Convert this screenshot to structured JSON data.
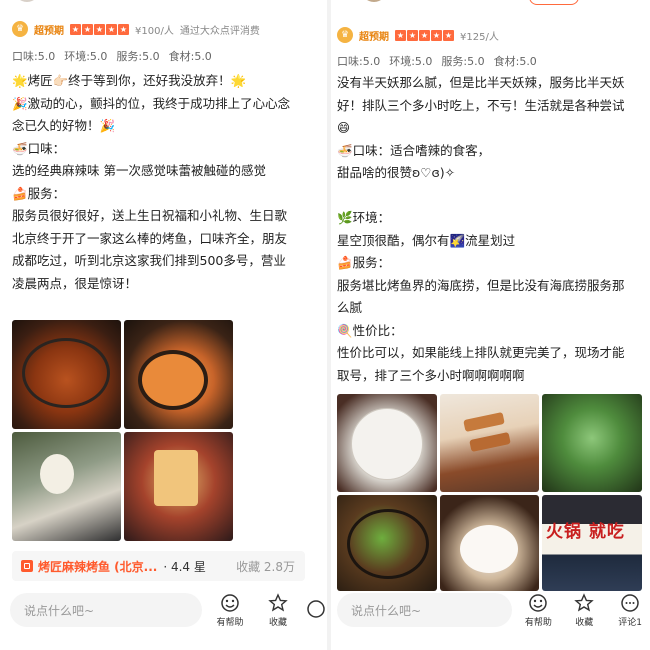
{
  "left": {
    "vip_label": "超预期",
    "price": "¥100/人",
    "verified": "通过大众点评消费",
    "scores": [
      "口味:5.0",
      "环境:5.0",
      "服务:5.0",
      "食材:5.0"
    ],
    "lines": [
      "🌟烤匠👉🏻终于等到你，还好我没放弃！🌟",
      "🎉激动的心，颤抖的位，我终于成功排上了心心念",
      "念已久的好物！🎉",
      "🍜口味：",
      "选的经典麻辣味 第一次感觉味蕾被触碰的感觉",
      "🍰服务：",
      "服务员很好很好，送上生日祝福和小礼物、生日歌",
      "北京终于开了一家这么棒的烤鱼，口味齐全，朋友",
      "成都吃过，听到北京这家我们排到500多号，营业",
      "凌晨两点，很是惊讶！"
    ],
    "poi": {
      "name": "烤匠麻辣烤鱼 (北京...",
      "rating": "· 4.4 星",
      "favorites": "收藏 2.8万"
    },
    "comment_placeholder": "说点什么吧~",
    "actions": [
      "有帮助",
      "收藏",
      ""
    ]
  },
  "right": {
    "vip_label": "超预期",
    "price": "¥125/人",
    "scores": [
      "口味:5.0",
      "环境:5.0",
      "服务:5.0",
      "食材:5.0"
    ],
    "lines": [
      "没有半天妖那么腻，但是比半天妖辣，服务比半天妖",
      "好！排队三个多小时吃上，不亏！生活就是各种尝试",
      "😄",
      "🍜口味：适合嗜辣的食客，",
      "甜品啥的很赞ʚ♡ɞ)✧",
      "",
      "🌿环境：",
      "星空顶很酷，偶尔有🌠流星划过",
      "🍰服务：",
      "服务堪比烤鱼界的海底捞，但是比没有海底捞服务那",
      "么腻",
      "🍭性价比：",
      "性价比可以，如果能线上排队就更完美了，现场才能",
      "取号，排了三个多小时啊啊啊啊啊"
    ],
    "photo_sign": "火锅 就吃",
    "comment_placeholder": "说点什么吧~",
    "actions": [
      "有帮助",
      "收藏",
      "评论1"
    ]
  },
  "colors": {
    "accent": "#ff5a2d",
    "vip": "#e8830e",
    "star": "#ff6a3d"
  },
  "icons": [
    "vip-crown-icon",
    "star-icon",
    "shop-icon",
    "helpful-icon",
    "bookmark-star-icon",
    "comment-icon"
  ]
}
